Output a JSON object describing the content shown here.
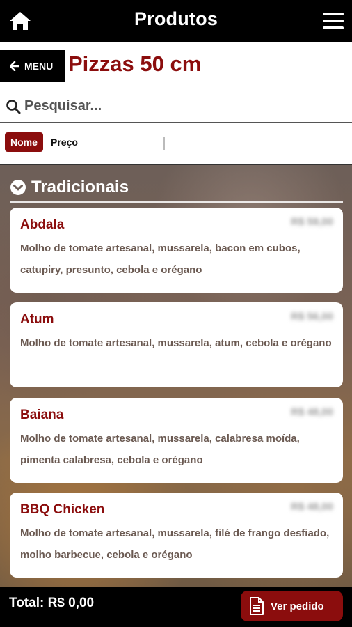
{
  "header": {
    "title": "Produtos",
    "home_icon": "home-icon",
    "menu_icon": "hamburger-menu-icon"
  },
  "nav": {
    "back_label": "MENU",
    "page_title": "Pizzas 50 cm"
  },
  "search": {
    "placeholder": "Pesquisar...",
    "value": ""
  },
  "sort": {
    "nome_label": "Nome",
    "preco_label": "Preço"
  },
  "section": {
    "title": "Tradicionais"
  },
  "products": [
    {
      "name": "Abdala",
      "description": "Molho de tomate artesanal, mussarela, bacon em cubos, catupiry, presunto, cebola e orégano",
      "price": "R$ 59,00"
    },
    {
      "name": "Atum",
      "description": "Molho de tomate artesanal, mussarela, atum, cebola e orégano",
      "price": "R$ 56,00"
    },
    {
      "name": "Baiana",
      "description": "Molho de tomate artesanal, mussarela, calabresa moída, pimenta calabresa, cebola e orégano",
      "price": "R$ 48,00"
    },
    {
      "name": "BBQ Chicken",
      "description": "Molho de tomate artesanal, mussarela, filé de frango desfiado, molho barbecue, cebola e orégano",
      "price": "R$ 48,00"
    }
  ],
  "footer": {
    "total_label": "Total: R$ 0,00",
    "order_button": "Ver pedido"
  },
  "colors": {
    "brand": "#8b0d0d",
    "topbar": "#000000",
    "text_muted": "#6b5a52"
  }
}
